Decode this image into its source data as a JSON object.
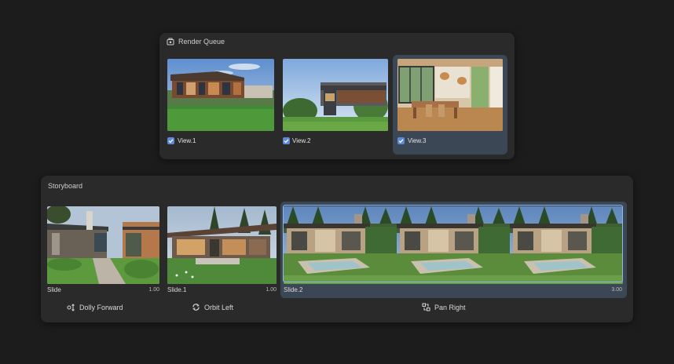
{
  "render_queue": {
    "title": "Render Queue",
    "items": [
      {
        "label": "View.1",
        "checked": true
      },
      {
        "label": "View.2",
        "checked": true
      },
      {
        "label": "View.3",
        "checked": true,
        "selected": true
      }
    ]
  },
  "storyboard": {
    "title": "Storyboard",
    "clips": [
      {
        "label": "Slide",
        "duration": "1.00",
        "transition": "Dolly Forward",
        "transition_icon": "dolly-forward-icon"
      },
      {
        "label": "Slide.1",
        "duration": "1.00",
        "transition": "Orbit Left",
        "transition_icon": "orbit-left-icon"
      },
      {
        "label": "Slide.2",
        "duration": "3.00",
        "transition": "Pan Right",
        "transition_icon": "pan-right-icon",
        "selected": true
      }
    ]
  },
  "colors": {
    "background": "#1c1c1d",
    "panel": "#2a2a2b",
    "selected": "#3c4756",
    "accent": "#5c8ad6",
    "selection_border": "#8fb6e6"
  }
}
